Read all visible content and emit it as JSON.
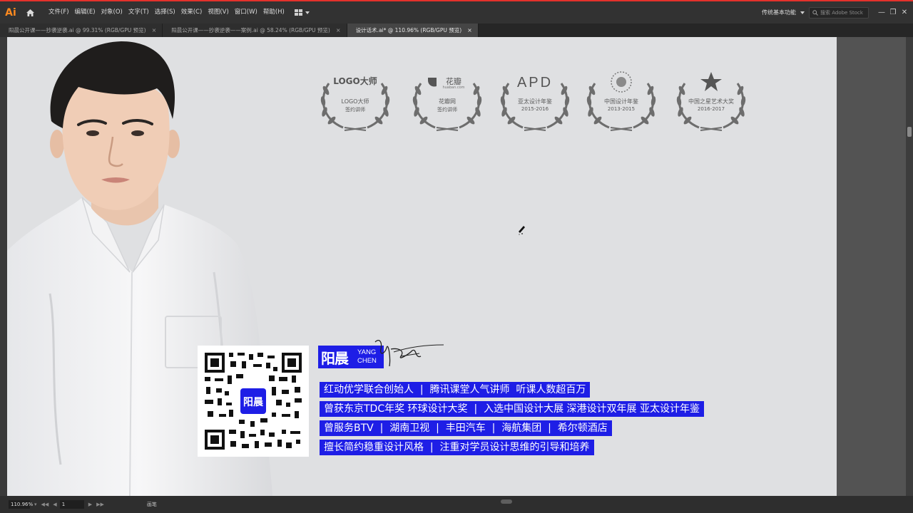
{
  "menubar": {
    "app_logo": "Ai",
    "items": [
      "文件(F)",
      "编辑(E)",
      "对象(O)",
      "文字(T)",
      "选择(S)",
      "效果(C)",
      "视图(V)",
      "窗口(W)",
      "帮助(H)"
    ],
    "workspace": "传统基本功能",
    "stock_search_placeholder": "搜索 Adobe Stock",
    "accent_color": "#e4312b"
  },
  "tabs": [
    {
      "label": "阳晨公开课——抄袭逆袭.ai @ 99.31% (RGB/GPU 预览)",
      "close": "×"
    },
    {
      "label": "阳晨公开课——抄袭逆袭——案例.ai @ 58.24% (RGB/GPU 预览)",
      "close": "×"
    },
    {
      "label": "设计话术.ai* @ 110.96% (RGB/GPU 预览)",
      "close": "×"
    }
  ],
  "awards": [
    {
      "mark": "LOGO大师",
      "line1": "LOGO大师",
      "line2": "签约讲师"
    },
    {
      "mark": "花瓣",
      "sub": "huaban.com",
      "line1": "花瓣网",
      "line2": "签约讲师"
    },
    {
      "mark": "APD",
      "line1": "亚太设计年鉴",
      "line2": "2015-2016"
    },
    {
      "line1": "中国设计年鉴",
      "line2": "2013-2015"
    },
    {
      "line1": "中国之星艺术大奖",
      "line2": "2016-2017"
    }
  ],
  "brand": {
    "cn": "阳晨",
    "en_line1": "YANG",
    "en_line2": "CHEN",
    "color": "#1e1ee6"
  },
  "info_lines": [
    "红动优学联合创始人  |  腾讯课堂人气讲师  听课人数超百万",
    "曾获东京TDC年奖 环球设计大奖  |  入选中国设计大展 深港设计双年展 亚太设计年鉴",
    "曾服务BTV  |  湖南卫视  |  丰田汽车  |  海航集团  |  希尔顿酒店",
    "擅长简约稳重设计风格  |  注重对学员设计思维的引导和培养"
  ],
  "statusbar": {
    "zoom": "110.96%",
    "page": "1",
    "tool": "画笔"
  }
}
